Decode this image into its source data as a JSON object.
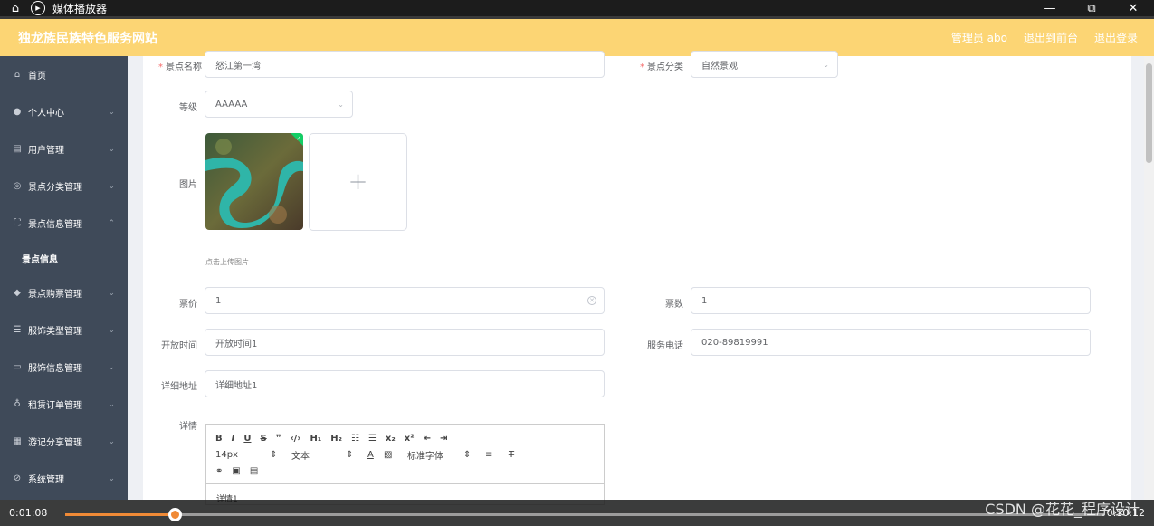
{
  "player": {
    "title": "媒体播放器",
    "current_time": "0:01:08",
    "total_time": "0:10:12",
    "progress": 0.105,
    "watermark": "CSDN @花花_程序设计"
  },
  "header": {
    "site_title": "独龙族民族特色服务网站",
    "admin_label": "管理员 abo",
    "back_label": "退出到前台",
    "logout_label": "退出登录"
  },
  "sidebar": {
    "items": [
      {
        "label": "首页",
        "icon": "home-icon",
        "glyph": "⌂",
        "chevron": ""
      },
      {
        "label": "个人中心",
        "icon": "user-icon",
        "glyph": "●",
        "chevron": "⌄"
      },
      {
        "label": "用户管理",
        "icon": "list-icon",
        "glyph": "▤",
        "chevron": "⌄"
      },
      {
        "label": "景点分类管理",
        "icon": "circle-icon",
        "glyph": "◎",
        "chevron": "⌄"
      },
      {
        "label": "景点信息管理",
        "icon": "frame-icon",
        "glyph": "⛶",
        "chevron": "⌃"
      },
      {
        "label": "景点购票管理",
        "icon": "pin-icon",
        "glyph": "◆",
        "chevron": "⌄"
      },
      {
        "label": "服饰类型管理",
        "icon": "menu-icon",
        "glyph": "☰",
        "chevron": "⌄"
      },
      {
        "label": "服饰信息管理",
        "icon": "chat-icon",
        "glyph": "▭",
        "chevron": "⌄"
      },
      {
        "label": "租赁订单管理",
        "icon": "mic-icon",
        "glyph": "♁",
        "chevron": "⌄"
      },
      {
        "label": "游记分享管理",
        "icon": "grid-icon",
        "glyph": "▦",
        "chevron": "⌄"
      },
      {
        "label": "系统管理",
        "icon": "compass-icon",
        "glyph": "⊘",
        "chevron": "⌄"
      }
    ],
    "sub_item": "景点信息"
  },
  "form": {
    "name_label": "景点名称",
    "name_value": "怒江第一湾",
    "category_label": "景点分类",
    "category_value": "自然景观",
    "level_label": "等级",
    "level_value": "AAAAA",
    "image_label": "图片",
    "upload_hint": "点击上传图片",
    "price_label": "票价",
    "price_value": "1",
    "count_label": "票数",
    "count_value": "1",
    "open_label": "开放时间",
    "open_value": "开放时间1",
    "phone_label": "服务电话",
    "phone_value": "020-89819991",
    "address_label": "详细地址",
    "address_value": "详细地址1",
    "detail_label": "详情",
    "editor": {
      "font_size": "14px",
      "text_style": "文本",
      "font_family": "标准字体",
      "body": "详情1"
    }
  }
}
